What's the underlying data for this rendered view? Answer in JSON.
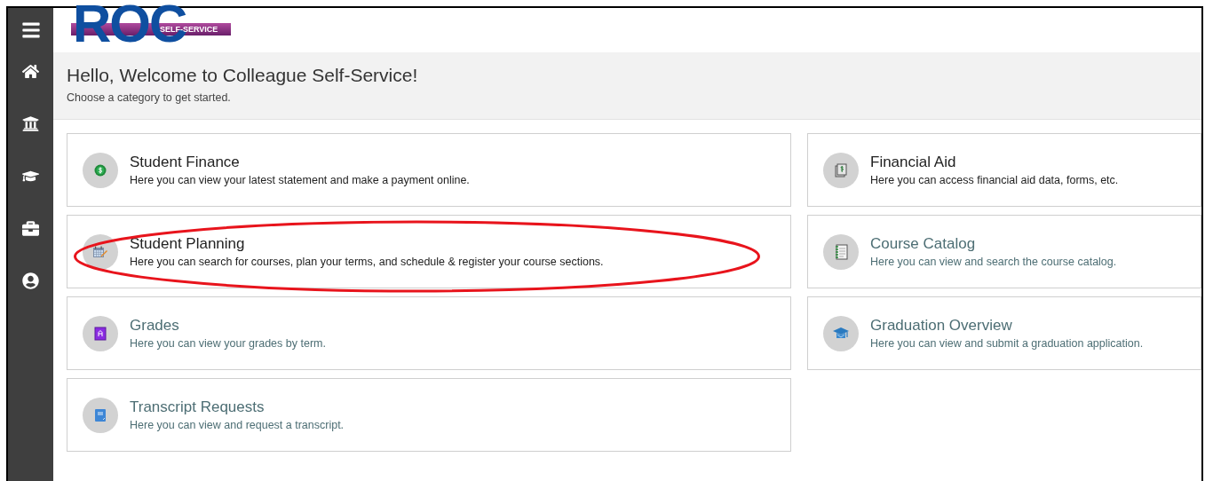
{
  "logo": {
    "letters": "ROC",
    "tag": "SELF-SERVICE"
  },
  "welcome": {
    "title": "Hello, Welcome to Colleague Self-Service!",
    "subtitle": "Choose a category to get started."
  },
  "cards": [
    {
      "title": "Student Finance",
      "description": "Here you can view your latest statement and make a payment online.",
      "visited": false,
      "circled": false
    },
    {
      "title": "Financial Aid",
      "description": "Here you can access financial aid data, forms, etc.",
      "visited": false,
      "circled": false
    },
    {
      "title": "Student Planning",
      "description": "Here you can search for courses, plan your terms, and schedule & register your course sections.",
      "visited": false,
      "circled": true
    },
    {
      "title": "Course Catalog",
      "description": "Here you can view and search the course catalog.",
      "visited": true,
      "circled": false
    },
    {
      "title": "Grades",
      "description": "Here you can view your grades by term.",
      "visited": true,
      "circled": false
    },
    {
      "title": "Graduation Overview",
      "description": "Here you can view and submit a graduation application.",
      "visited": true,
      "circled": false
    },
    {
      "title": "Transcript Requests",
      "description": "Here you can view and request a transcript.",
      "visited": true,
      "circled": false
    }
  ]
}
